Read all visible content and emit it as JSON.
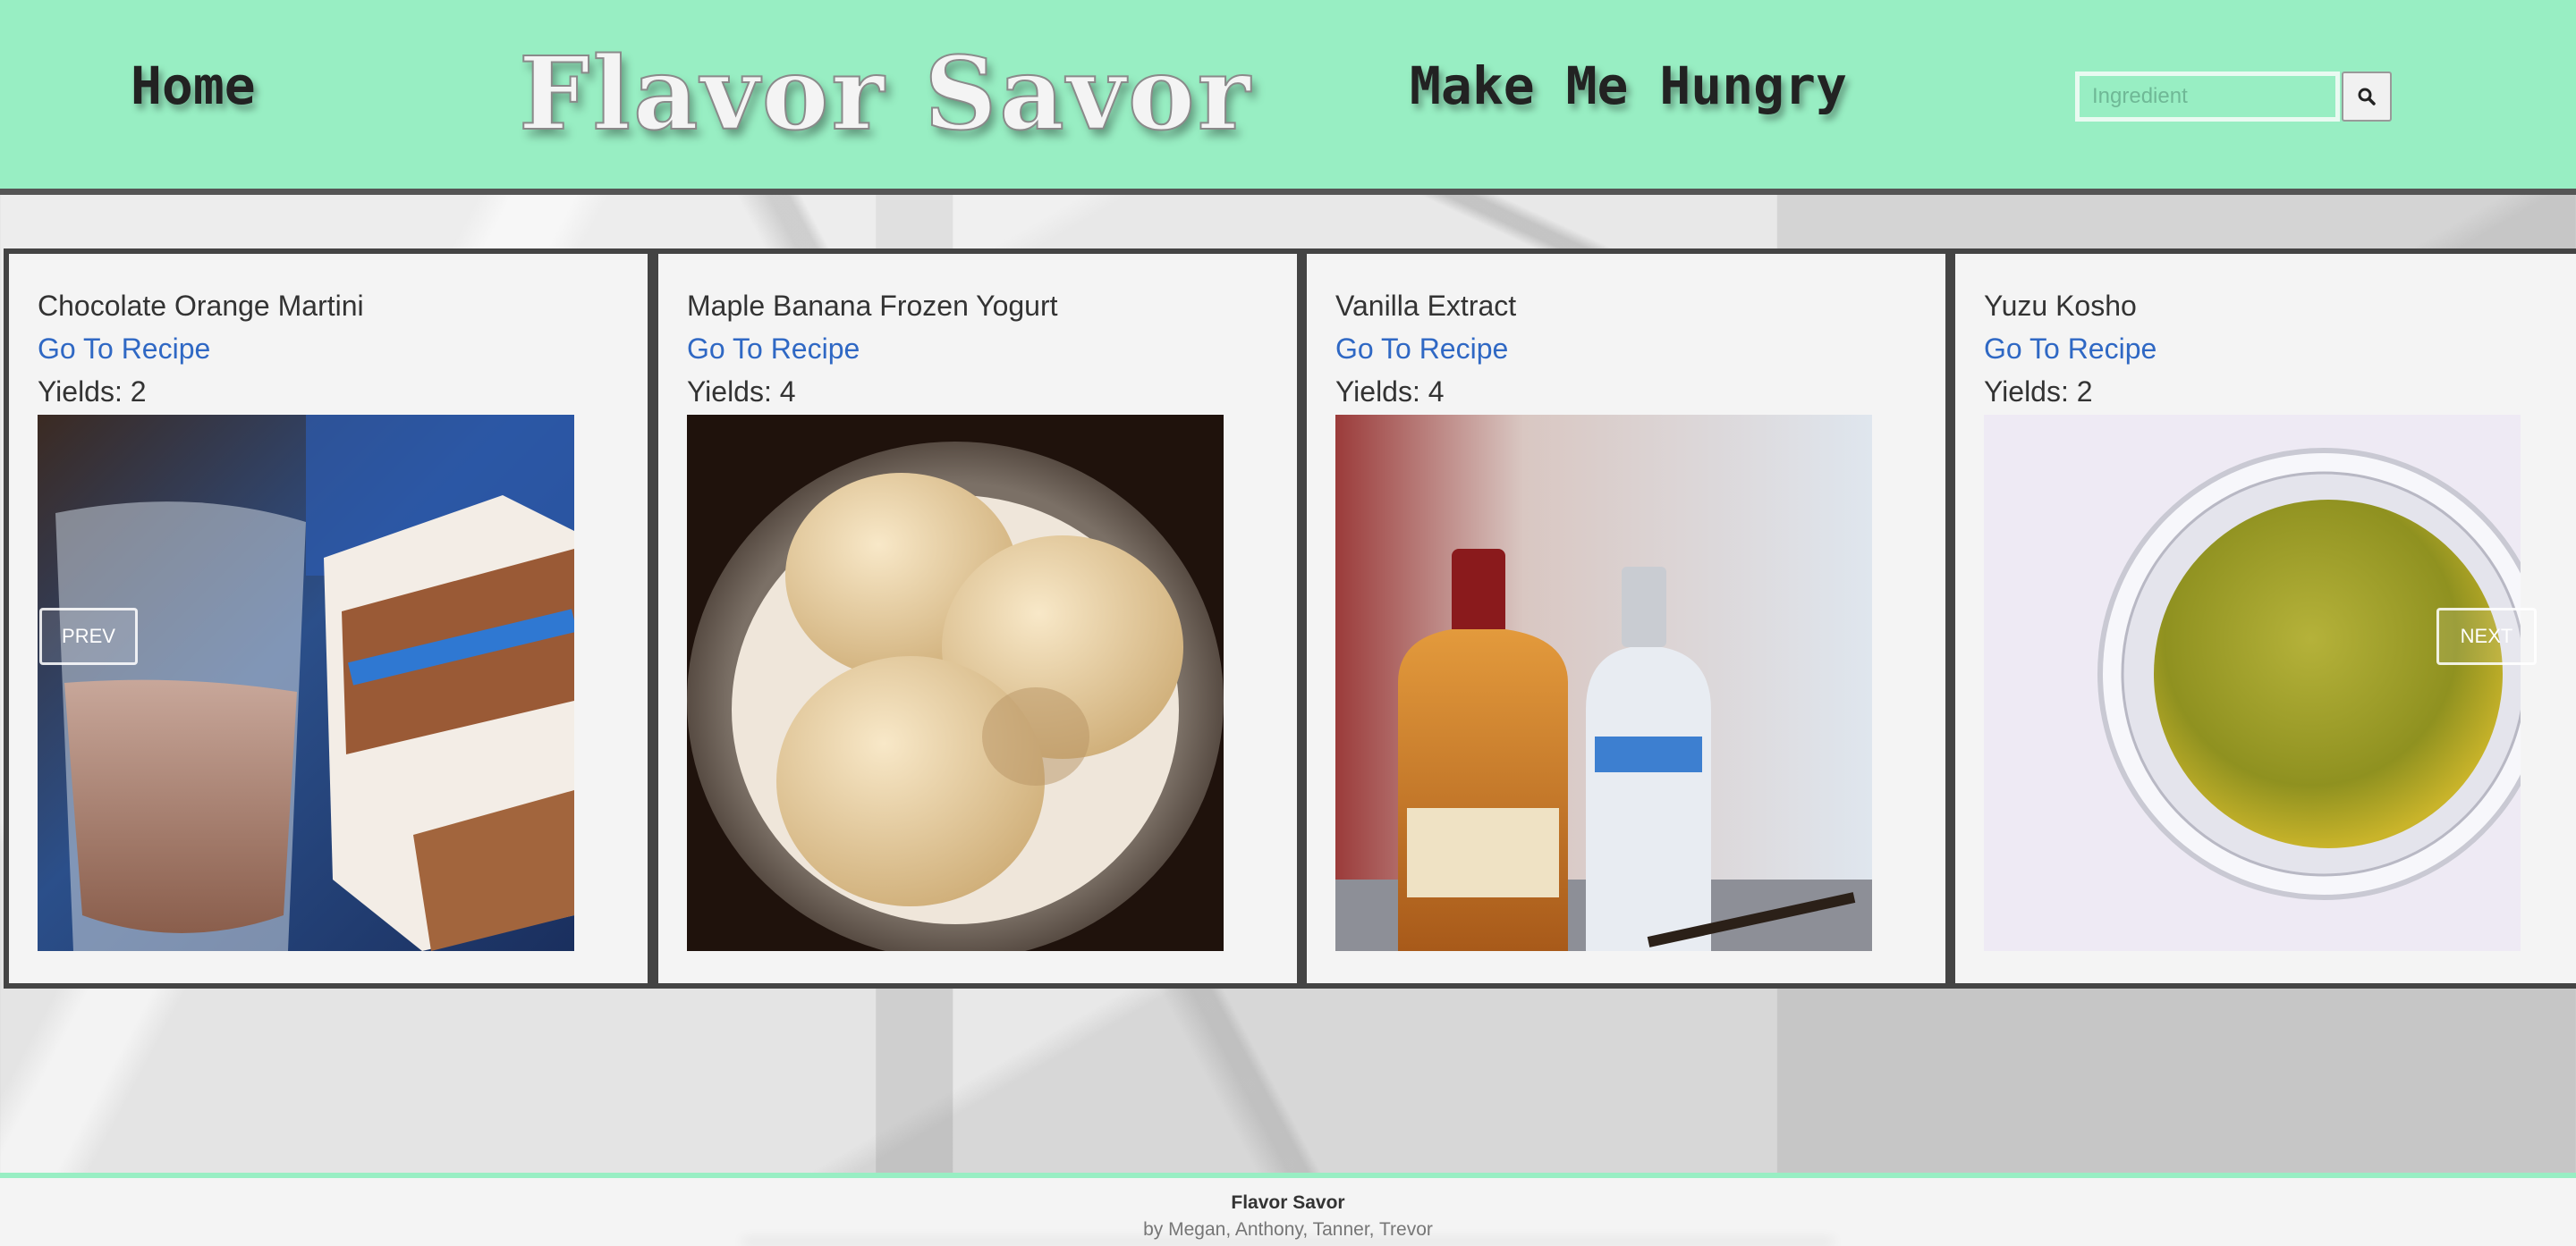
{
  "header": {
    "home_label": "Home",
    "brand": "Flavor Savor",
    "hungry_label": "Make Me Hungry",
    "search": {
      "placeholder": "Ingredient",
      "value": "",
      "button_icon": "search-icon"
    },
    "background_color": "#98eec3"
  },
  "carousel": {
    "prev_label": "PREV",
    "next_label": "NEXT",
    "cards": [
      {
        "title": "Chocolate Orange Martini",
        "link_label": "Go To Recipe",
        "yields": "Yields: 2"
      },
      {
        "title": "Maple Banana Frozen Yogurt",
        "link_label": "Go To Recipe",
        "yields": "Yields: 4"
      },
      {
        "title": "Vanilla Extract",
        "link_label": "Go To Recipe",
        "yields": "Yields: 4"
      },
      {
        "title": "Yuzu Kosho",
        "link_label": "Go To Recipe",
        "yields": "Yields: 2"
      }
    ]
  },
  "footer": {
    "title": "Flavor Savor",
    "credit": "by Megan, Anthony, Tanner, Trevor"
  },
  "colors": {
    "accent": "#98eec3",
    "link": "#2f68c4",
    "border": "#444444"
  }
}
